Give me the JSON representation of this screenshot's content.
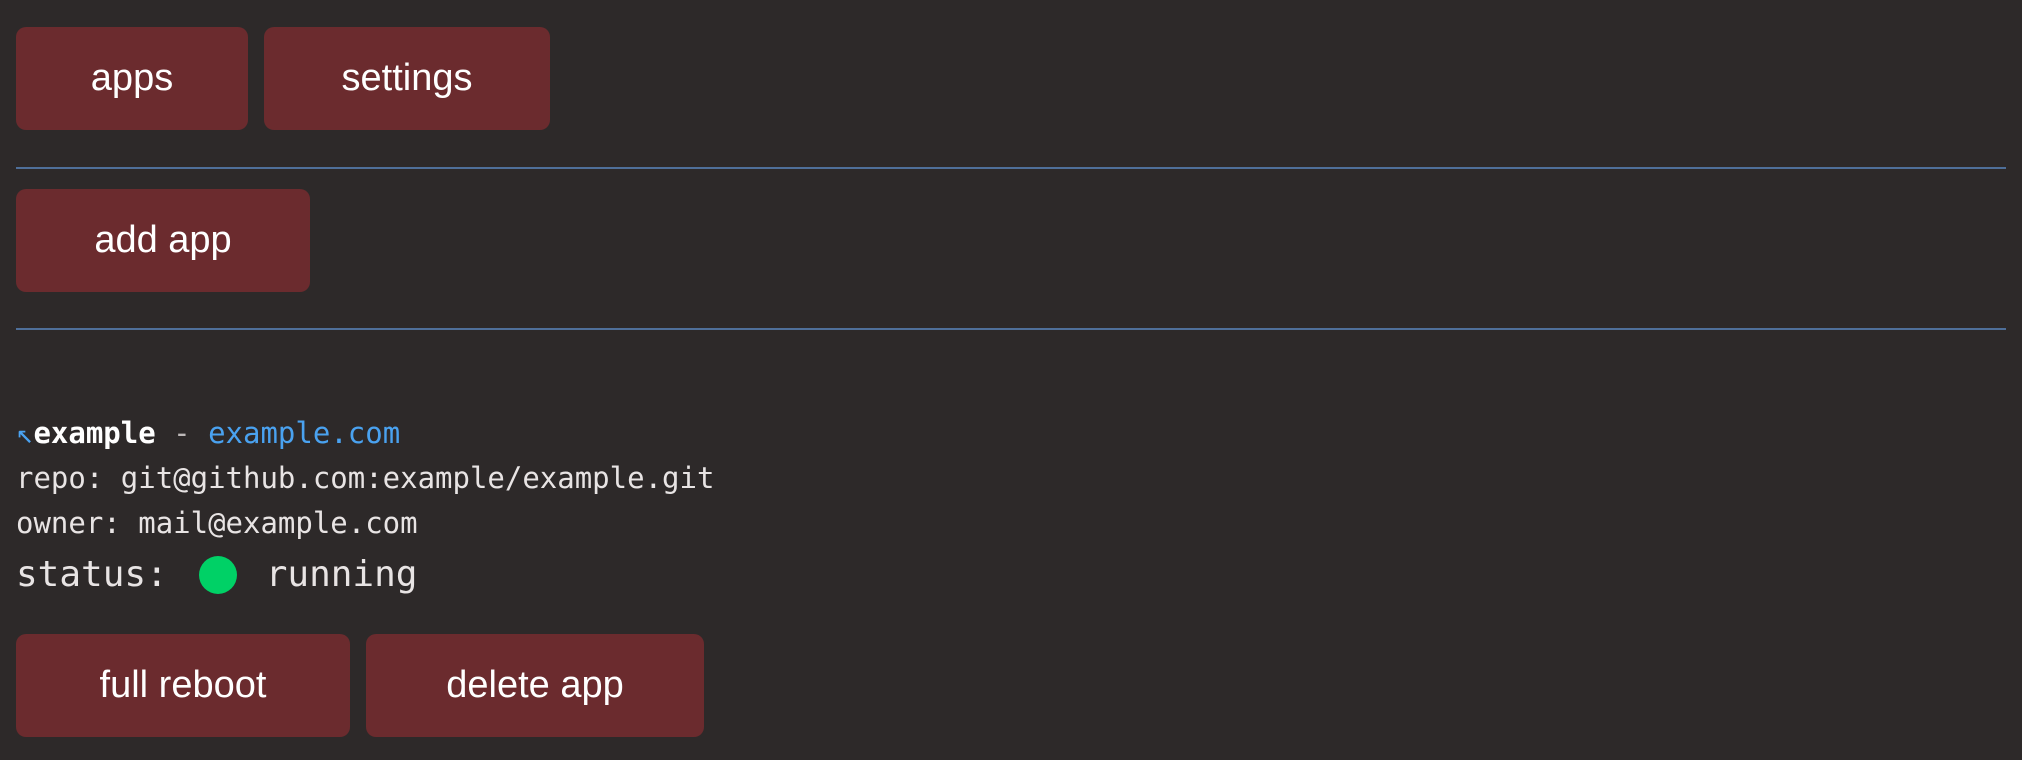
{
  "nav": {
    "apps_label": "apps",
    "settings_label": "settings"
  },
  "toolbar": {
    "add_app_label": "add app"
  },
  "app": {
    "arrow_glyph": "↖",
    "name": "example",
    "separator": "-",
    "url": "example.com",
    "repo_label": "repo:",
    "repo_value": "git@github.com:example/example.git",
    "owner_label": "owner:",
    "owner_value": "mail@example.com",
    "status_label": "status:",
    "status_value": "running",
    "status_color": "#00d166",
    "full_reboot_label": "full reboot",
    "delete_app_label": "delete app"
  },
  "colors": {
    "background": "#2d2929",
    "button": "#6b2b2e",
    "divider": "#4f6f99",
    "link": "#4aa2f0"
  }
}
